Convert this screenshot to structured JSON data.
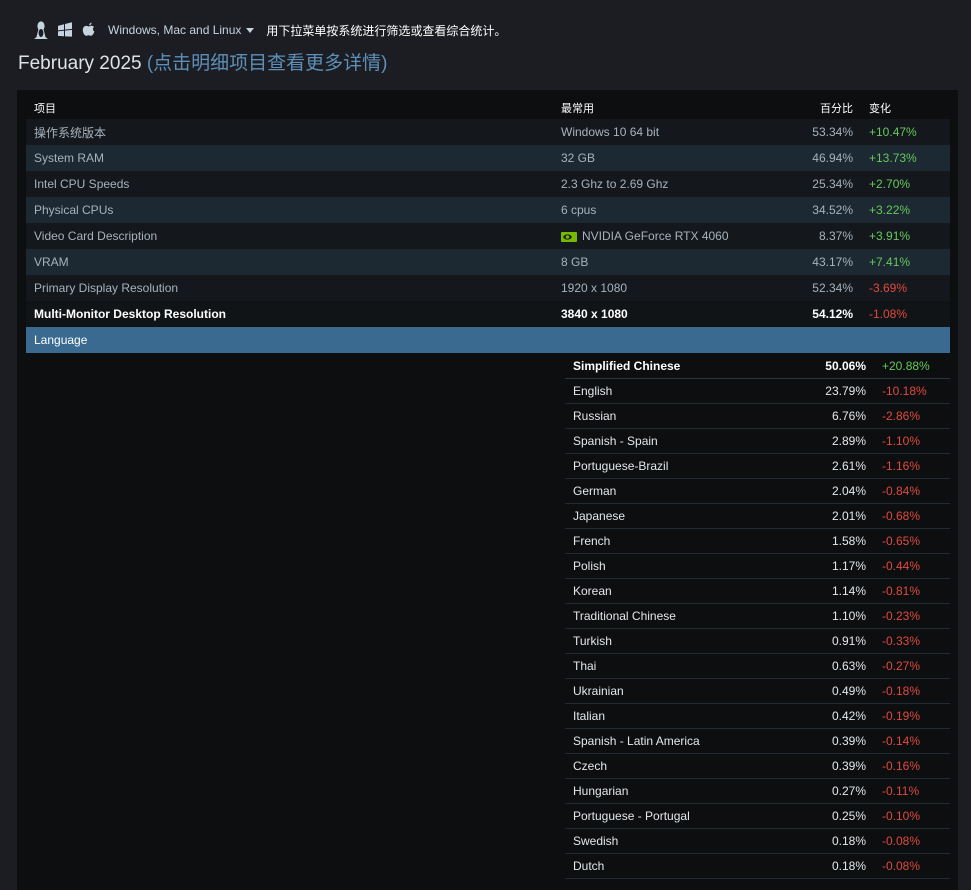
{
  "header": {
    "os_icons": [
      "linux-icon",
      "windows-icon",
      "apple-icon"
    ],
    "os_filter_label": "Windows, Mac and Linux",
    "hint": "用下拉菜单按系统进行筛选或查看综合统计。",
    "title_main": "February 2025",
    "title_sub": "(点击明细项目查看更多详情)"
  },
  "table": {
    "columns": [
      "项目",
      "最常用",
      "百分比",
      "变化"
    ],
    "rows": [
      {
        "item": "操作系统版本",
        "common": "Windows 10 64 bit",
        "percent": "53.34%",
        "change": "+10.47%"
      },
      {
        "item": "System RAM",
        "common": "32 GB",
        "percent": "46.94%",
        "change": "+13.73%"
      },
      {
        "item": "Intel CPU Speeds",
        "common": "2.3 Ghz to 2.69 Ghz",
        "percent": "25.34%",
        "change": "+2.70%"
      },
      {
        "item": "Physical CPUs",
        "common": "6 cpus",
        "percent": "34.52%",
        "change": "+3.22%"
      },
      {
        "item": "Video Card Description",
        "common": "NVIDIA GeForce RTX 4060",
        "percent": "8.37%",
        "change": "+3.91%",
        "icon": "nvidia-icon"
      },
      {
        "item": "VRAM",
        "common": "8 GB",
        "percent": "43.17%",
        "change": "+7.41%"
      },
      {
        "item": "Primary Display Resolution",
        "common": "1920 x 1080",
        "percent": "52.34%",
        "change": "-3.69%"
      },
      {
        "item": "Multi-Monitor Desktop Resolution",
        "common": "3840 x 1080",
        "percent": "54.12%",
        "change": "-1.08%"
      }
    ],
    "expanded_label": "Language",
    "colors": {
      "positive": "#66c95a",
      "negative": "#e04a3f",
      "expanded_bg": "#3a6a8f"
    }
  },
  "languages": [
    {
      "name": "Simplified Chinese",
      "percent": "50.06%",
      "change": "+20.88%"
    },
    {
      "name": "English",
      "percent": "23.79%",
      "change": "-10.18%"
    },
    {
      "name": "Russian",
      "percent": "6.76%",
      "change": "-2.86%"
    },
    {
      "name": "Spanish - Spain",
      "percent": "2.89%",
      "change": "-1.10%"
    },
    {
      "name": "Portuguese-Brazil",
      "percent": "2.61%",
      "change": "-1.16%"
    },
    {
      "name": "German",
      "percent": "2.04%",
      "change": "-0.84%"
    },
    {
      "name": "Japanese",
      "percent": "2.01%",
      "change": "-0.68%"
    },
    {
      "name": "French",
      "percent": "1.58%",
      "change": "-0.65%"
    },
    {
      "name": "Polish",
      "percent": "1.17%",
      "change": "-0.44%"
    },
    {
      "name": "Korean",
      "percent": "1.14%",
      "change": "-0.81%"
    },
    {
      "name": "Traditional Chinese",
      "percent": "1.10%",
      "change": "-0.23%"
    },
    {
      "name": "Turkish",
      "percent": "0.91%",
      "change": "-0.33%"
    },
    {
      "name": "Thai",
      "percent": "0.63%",
      "change": "-0.27%"
    },
    {
      "name": "Ukrainian",
      "percent": "0.49%",
      "change": "-0.18%"
    },
    {
      "name": "Italian",
      "percent": "0.42%",
      "change": "-0.19%"
    },
    {
      "name": "Spanish - Latin America",
      "percent": "0.39%",
      "change": "-0.14%"
    },
    {
      "name": "Czech",
      "percent": "0.39%",
      "change": "-0.16%"
    },
    {
      "name": "Hungarian",
      "percent": "0.27%",
      "change": "-0.11%"
    },
    {
      "name": "Portuguese - Portugal",
      "percent": "0.25%",
      "change": "-0.10%"
    },
    {
      "name": "Swedish",
      "percent": "0.18%",
      "change": "-0.08%"
    },
    {
      "name": "Dutch",
      "percent": "0.18%",
      "change": "-0.08%"
    }
  ]
}
